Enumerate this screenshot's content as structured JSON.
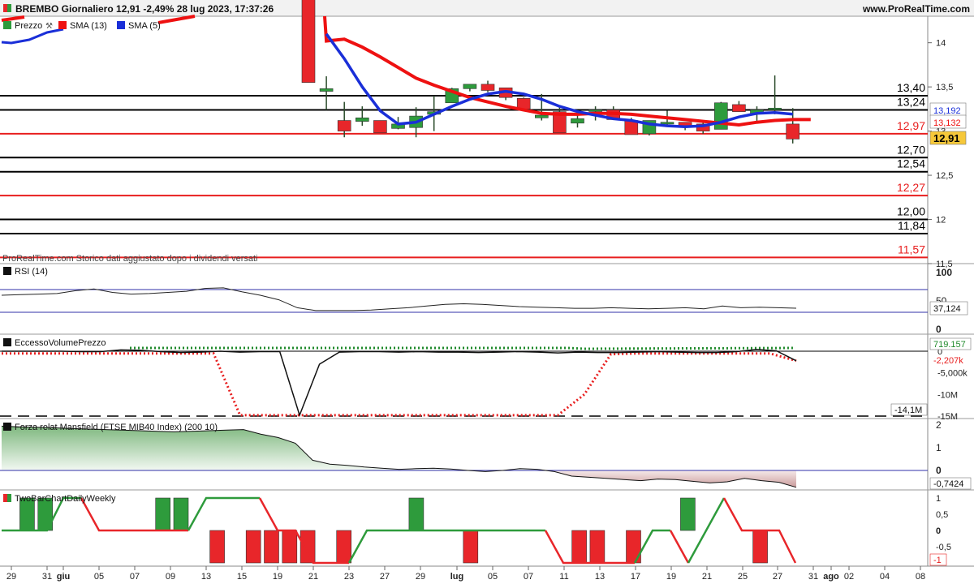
{
  "header": {
    "title": "BREMBO Giornaliero 12,91 -2,49% 28 lug 2023, 17:37:26",
    "brand": "www.ProRealTime.com"
  },
  "colors": {
    "up": "#2e9b3c",
    "down": "#e8262a",
    "sma13": "#ee1111",
    "sma5": "#1a2fd8",
    "level_black": "#000000",
    "level_red": "#e81e1e",
    "rsi_band": "#3232aa",
    "price_tag_bg": "#f6c83a"
  },
  "panels": {
    "price": {
      "legend": [
        {
          "label": "Prezzo",
          "swatch": "#2e9b3c"
        },
        {
          "label": "SMA (13)",
          "swatch": "#ee1111"
        },
        {
          "label": "SMA (5)",
          "swatch": "#1a2fd8"
        }
      ],
      "watermark": "ProRealTime.com  Storico dati aggiustato dopo i dividendi versati",
      "y_ticks": [
        "14",
        "13,5",
        "13",
        "12,5",
        "12",
        "11,5"
      ],
      "right_tags": {
        "sma5": "13,192",
        "sma13": "13,132",
        "last": "12,91"
      }
    },
    "rsi": {
      "legend": "RSI (14)",
      "y_ticks": [
        "100",
        "50",
        "0"
      ],
      "value_tag": "37,124"
    },
    "evp": {
      "legend": "EccessoVolumePrezzo",
      "y_ticks": [
        "0",
        "-5,000k",
        "-10M",
        "-15M"
      ],
      "tags": [
        "719.157",
        "-2.207k",
        "-2,207k",
        "-14,1M"
      ]
    },
    "mansfield": {
      "legend": "Forza relat Mansfield (FTSE MIB40 Index) (200 10)",
      "y_ticks": [
        "2",
        "1",
        "0",
        "-1"
      ],
      "value_tag": "-0,7424"
    },
    "twobar": {
      "legend": "TwoBarChartDailyWeekly",
      "y_ticks": [
        "1",
        "0,5",
        "0",
        "-0,5"
      ],
      "tags": [
        "0",
        "-1"
      ]
    }
  },
  "x_axis": {
    "labels": [
      "29",
      "31",
      "giu",
      "05",
      "07",
      "09",
      "13",
      "15",
      "19",
      "21",
      "23",
      "27",
      "29",
      "lug",
      "05",
      "07",
      "11",
      "13",
      "17",
      "19",
      "21",
      "25",
      "27",
      "31",
      "ago",
      "02",
      "04",
      "08"
    ]
  },
  "chart_data": [
    {
      "type": "candlestick",
      "title": "BREMBO Giornaliero",
      "x": [
        "2023-06-20",
        "2023-06-21",
        "2023-06-22",
        "2023-06-23",
        "2023-06-26",
        "2023-06-27",
        "2023-06-28",
        "2023-06-29",
        "2023-06-30",
        "2023-07-03",
        "2023-07-04",
        "2023-07-05",
        "2023-07-06",
        "2023-07-07",
        "2023-07-10",
        "2023-07-11",
        "2023-07-12",
        "2023-07-13",
        "2023-07-14",
        "2023-07-17",
        "2023-07-18",
        "2023-07-19",
        "2023-07-20",
        "2023-07-21",
        "2023-07-24",
        "2023-07-25",
        "2023-07-26",
        "2023-07-27",
        "2023-07-28"
      ],
      "series": [
        {
          "name": "Prezzo",
          "ohlc": [
            [
              14.6,
              14.6,
              13.55,
              13.55
            ],
            [
              13.45,
              13.62,
              13.24,
              13.48
            ],
            [
              13.12,
              13.33,
              12.93,
              13.0
            ],
            [
              13.11,
              13.28,
              13.06,
              13.15
            ],
            [
              13.12,
              13.12,
              12.98,
              12.98
            ],
            [
              13.03,
              13.16,
              13.02,
              13.08
            ],
            [
              13.04,
              13.27,
              12.93,
              13.17
            ],
            [
              13.19,
              13.4,
              13.0,
              13.22
            ],
            [
              13.32,
              13.49,
              13.32,
              13.48
            ],
            [
              13.48,
              13.53,
              13.45,
              13.53
            ],
            [
              13.53,
              13.57,
              13.44,
              13.46
            ],
            [
              13.49,
              13.49,
              13.35,
              13.38
            ],
            [
              13.37,
              13.38,
              13.23,
              13.25
            ],
            [
              13.15,
              13.42,
              13.12,
              13.18
            ],
            [
              13.22,
              13.28,
              12.99,
              12.98
            ],
            [
              13.09,
              13.2,
              13.04,
              13.14
            ],
            [
              13.24,
              13.28,
              13.12,
              13.24
            ],
            [
              13.24,
              13.28,
              13.13,
              13.13
            ],
            [
              13.12,
              13.15,
              12.97,
              12.96
            ],
            [
              12.97,
              13.12,
              12.95,
              13.12
            ],
            [
              13.08,
              13.23,
              13.06,
              13.1
            ],
            [
              13.1,
              13.09,
              13.01,
              13.05
            ],
            [
              13.08,
              13.11,
              12.97,
              13.0
            ],
            [
              13.02,
              13.33,
              13.02,
              13.32
            ],
            [
              13.3,
              13.34,
              13.22,
              13.22
            ],
            [
              13.2,
              13.28,
              13.1,
              13.24
            ],
            [
              13.25,
              13.63,
              13.19,
              13.26
            ],
            [
              13.08,
              13.26,
              12.86,
              12.91
            ]
          ]
        },
        {
          "name": "SMA (13)",
          "x_start": "2023-06-21",
          "values": [
            14.02,
            14.04,
            13.95,
            13.84,
            13.72,
            13.6,
            13.52,
            13.45,
            13.38,
            13.33,
            13.28,
            13.24,
            13.2,
            13.19,
            13.19,
            13.2,
            13.2,
            13.19,
            13.17,
            13.15,
            13.13,
            13.11,
            13.09,
            13.07,
            13.1,
            13.12,
            13.13,
            13.13
          ]
        },
        {
          "name": "SMA (5)",
          "x_start": "2023-06-21",
          "values": [
            14.1,
            13.82,
            13.5,
            13.23,
            13.08,
            13.1,
            13.19,
            13.28,
            13.36,
            13.42,
            13.45,
            13.42,
            13.36,
            13.28,
            13.22,
            13.18,
            13.14,
            13.12,
            13.08,
            13.06,
            13.05,
            13.06,
            13.1,
            13.16,
            13.2,
            13.21,
            13.192
          ]
        },
        {
          "name": "levels",
          "values": [
            13.4,
            13.24,
            12.97,
            12.7,
            12.54,
            12.27,
            12.0,
            11.84,
            11.57
          ]
        }
      ],
      "ylim": [
        11.5,
        14.3
      ]
    },
    {
      "type": "line",
      "title": "RSI (14)",
      "ylim": [
        0,
        100
      ],
      "bands": [
        70,
        30
      ],
      "values": [
        60,
        61,
        62,
        63,
        68,
        71,
        65,
        62,
        63,
        65,
        67,
        72,
        73,
        66,
        60,
        52,
        38,
        33,
        33,
        33,
        34,
        36,
        38,
        41,
        44,
        45,
        44,
        42,
        40,
        39,
        38,
        37,
        37,
        38,
        37,
        36,
        37,
        38,
        36,
        41,
        38,
        39,
        38,
        37.124
      ]
    },
    {
      "type": "line",
      "title": "EccessoVolumePrezzo",
      "ylim": [
        -16000000,
        1500000
      ],
      "series": [
        {
          "name": "line",
          "values": [
            0,
            0,
            0,
            0,
            -100000,
            -100000,
            300000,
            200000,
            -100000,
            -300000,
            -200000,
            0,
            -200000,
            -100000,
            -100000,
            -14800000,
            -3000000,
            -200000,
            -100000,
            -100000,
            -200000,
            -100000,
            -200000,
            -200000,
            -300000,
            -200000,
            -100000,
            -200000,
            -400000,
            -200000,
            -300000,
            -300000,
            -200000,
            -100000,
            -200000,
            -300000,
            -300000,
            -100000,
            400000,
            100000,
            -2207000
          ]
        },
        {
          "name": "signal-red",
          "values": [
            -500000,
            -500000,
            -500000,
            -500000,
            -500000,
            -500000,
            -500000,
            -500000,
            -500000,
            -14800000,
            -14800000,
            -14800000,
            -14800000,
            -14800000,
            -14800000,
            -14800000,
            -14800000,
            -14800000,
            -14800000,
            -14800000,
            -14800000,
            -14800000,
            -10000000,
            -700000,
            -500000,
            -500000,
            -500000,
            -500000,
            -500000,
            -500000,
            -2207000
          ]
        },
        {
          "name": "signal-green",
          "values": [
            719157
          ]
        }
      ]
    },
    {
      "type": "area",
      "title": "Forza relat Mansfield (FTSE MIB40 Index) (200 10)",
      "ylim": [
        -1,
        2
      ],
      "values": [
        1.95,
        1.92,
        1.9,
        1.88,
        1.85,
        1.82,
        1.8,
        1.78,
        1.75,
        1.72,
        1.7,
        1.72,
        1.75,
        1.78,
        1.8,
        1.6,
        1.45,
        1.2,
        0.45,
        0.28,
        0.22,
        0.15,
        0.1,
        0.05,
        0.08,
        0.1,
        0.06,
        0.0,
        -0.05,
        0.0,
        0.08,
        0.05,
        -0.05,
        -0.25,
        -0.3,
        -0.35,
        -0.4,
        -0.45,
        -0.38,
        -0.4,
        -0.48,
        -0.55,
        -0.5,
        -0.35,
        -0.45,
        -0.52,
        -0.7424
      ]
    },
    {
      "type": "bar",
      "title": "TwoBarChartDailyWeekly",
      "ylim": [
        -1,
        1
      ],
      "bars": [
        {
          "day": 1.5,
          "v": 1,
          "c": "up"
        },
        {
          "day": 2.5,
          "v": 1,
          "c": "up"
        },
        {
          "day": 9,
          "v": 1,
          "c": "up"
        },
        {
          "day": 10,
          "v": 1,
          "c": "up"
        },
        {
          "day": 12,
          "v": -1,
          "c": "down"
        },
        {
          "day": 14,
          "v": -1,
          "c": "down"
        },
        {
          "day": 15,
          "v": -1,
          "c": "down"
        },
        {
          "day": 16,
          "v": -1,
          "c": "down"
        },
        {
          "day": 17,
          "v": -1,
          "c": "down"
        },
        {
          "day": 19,
          "v": -1,
          "c": "down"
        },
        {
          "day": 23,
          "v": 1,
          "c": "up"
        },
        {
          "day": 26,
          "v": -1,
          "c": "down"
        },
        {
          "day": 32,
          "v": -1,
          "c": "down"
        },
        {
          "day": 33,
          "v": -1,
          "c": "down"
        },
        {
          "day": 35,
          "v": -1,
          "c": "down"
        },
        {
          "day": 38,
          "v": 1,
          "c": "up"
        },
        {
          "day": 42,
          "v": -1,
          "c": "down"
        }
      ]
    }
  ]
}
